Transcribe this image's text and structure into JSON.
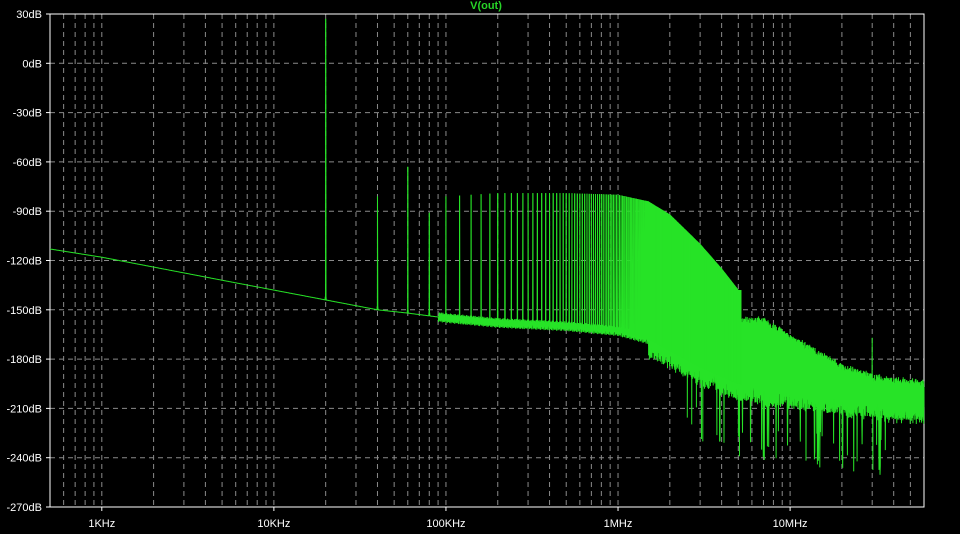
{
  "chart_data": {
    "type": "line",
    "title": "V(out)",
    "xscale": "log",
    "x_unit": "Hz",
    "xlim": [
      500,
      60000000
    ],
    "ylim": [
      -270,
      30
    ],
    "grid": true,
    "legend": "none",
    "ytick_labels": [
      "30dB",
      "0dB",
      "-30dB",
      "-60dB",
      "-90dB",
      "-120dB",
      "-150dB",
      "-180dB",
      "-210dB",
      "-240dB",
      "-270dB"
    ],
    "ytick_values": [
      30,
      0,
      -30,
      -60,
      -90,
      -120,
      -150,
      -180,
      -210,
      -240,
      -270
    ],
    "xtick_labels": [
      "1KHz",
      "10KHz",
      "100KHz",
      "1MHz",
      "10MHz"
    ],
    "xtick_values": [
      1000,
      10000,
      100000,
      1000000,
      10000000
    ],
    "series": [
      {
        "name": "V(out)",
        "color": "#27e327",
        "noise_floor": [
          [
            500,
            -113
          ],
          [
            1000,
            -118
          ],
          [
            2000,
            -124
          ],
          [
            5000,
            -132
          ],
          [
            10000,
            -138
          ],
          [
            20000,
            -144
          ],
          [
            40000,
            -150
          ],
          [
            60000,
            -152
          ],
          [
            100000,
            -155
          ],
          [
            200000,
            -158
          ],
          [
            500000,
            -160
          ],
          [
            1000000,
            -163
          ],
          [
            1500000,
            -168
          ],
          [
            2000000,
            -175
          ],
          [
            3000000,
            -185
          ],
          [
            5000000,
            -195
          ],
          [
            8000000,
            -198
          ],
          [
            15000000,
            -202
          ],
          [
            25000000,
            -205
          ],
          [
            40000000,
            -207
          ],
          [
            60000000,
            -208
          ]
        ],
        "upper_envelope": [
          [
            100000,
            -140
          ],
          [
            200000,
            -145
          ],
          [
            400000,
            -148
          ],
          [
            700000,
            -150
          ],
          [
            1000000,
            -152
          ],
          [
            1500000,
            -155
          ],
          [
            2000000,
            -158
          ],
          [
            3000000,
            -162
          ],
          [
            5000000,
            -160
          ],
          [
            7000000,
            -160
          ],
          [
            10000000,
            -170
          ],
          [
            20000000,
            -188
          ],
          [
            35000000,
            -196
          ],
          [
            60000000,
            -198
          ]
        ],
        "harmonic_peak_envelope": [
          [
            20000,
            27
          ],
          [
            40000,
            -81
          ],
          [
            60000,
            -63
          ],
          [
            80000,
            -91
          ],
          [
            100000,
            -81
          ],
          [
            200000,
            -79
          ],
          [
            500000,
            -79
          ],
          [
            1000000,
            -80
          ],
          [
            1500000,
            -84
          ],
          [
            2000000,
            -92
          ],
          [
            3000000,
            -110
          ],
          [
            4000000,
            -125
          ],
          [
            5000000,
            -138
          ]
        ],
        "fundamental_hz": 20000,
        "fundamental_db": 27,
        "spur_hz": 30000000,
        "spur_db": -167
      }
    ]
  }
}
